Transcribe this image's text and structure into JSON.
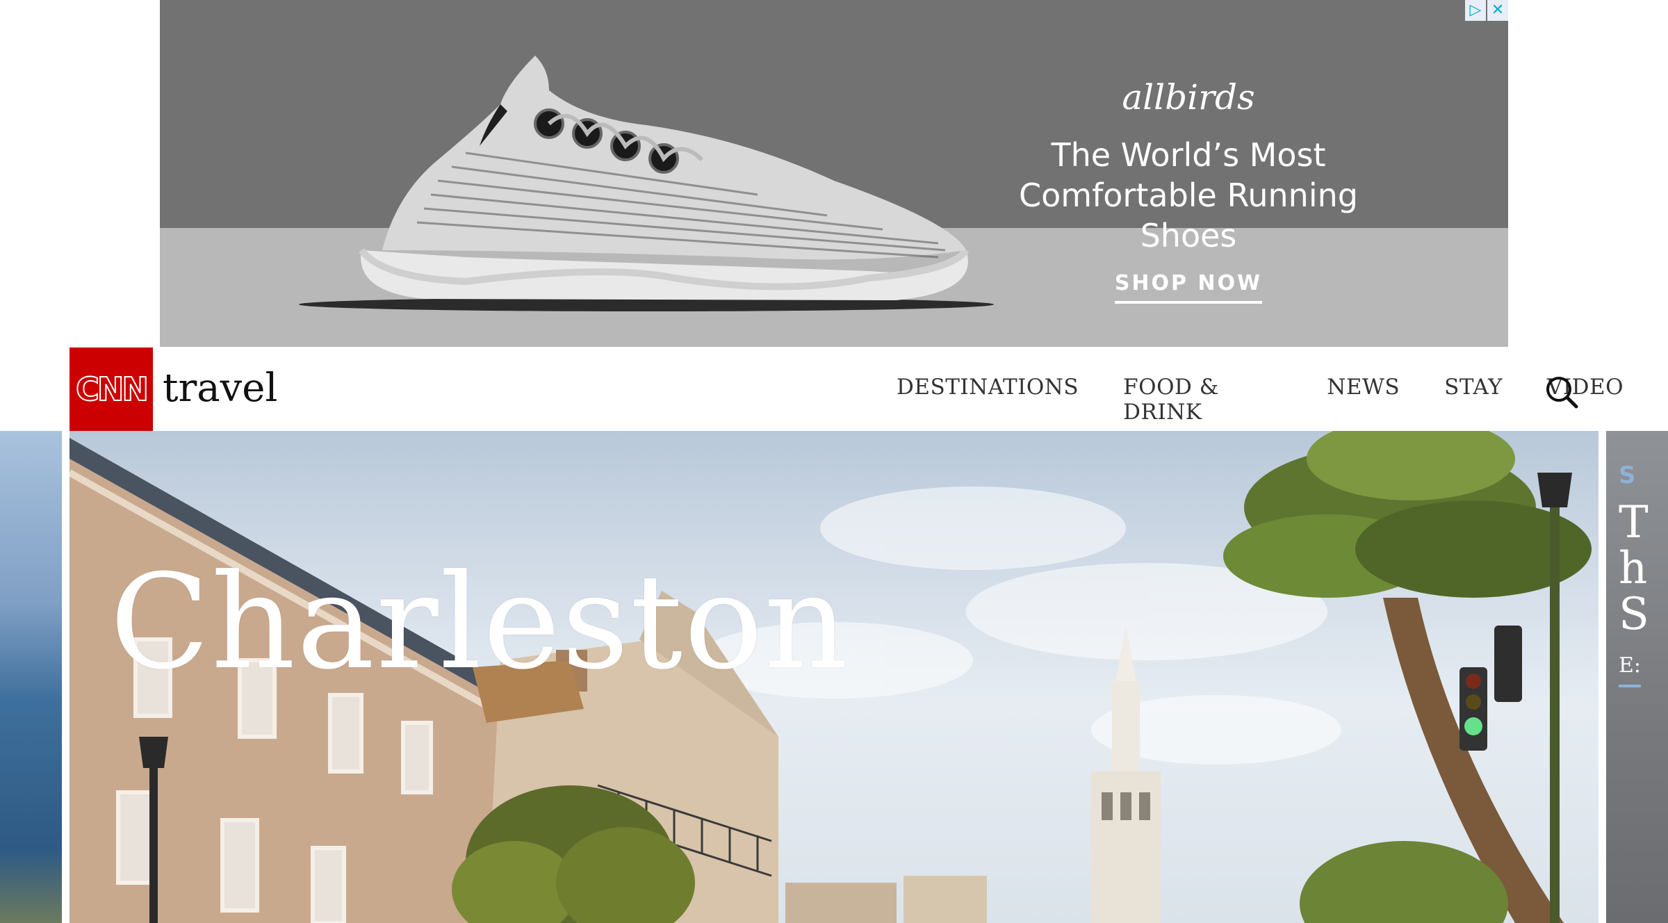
{
  "ad": {
    "brand": "allbirds",
    "headline_line1": "The World’s Most",
    "headline_line2": "Comfortable Running Shoes",
    "cta": "SHOP NOW",
    "adchoices_icon": "adchoices-icon",
    "close_icon": "close-icon"
  },
  "nav": {
    "logo": "CNN",
    "section": "travel",
    "items": [
      {
        "label": "DESTINATIONS"
      },
      {
        "label": "FOOD & DRINK"
      },
      {
        "label": "NEWS"
      },
      {
        "label": "STAY"
      },
      {
        "label": "VIDEO"
      }
    ],
    "search_icon": "search-icon"
  },
  "hero": {
    "title": "Charleston"
  },
  "next_slide": {
    "label_fragment": "S",
    "line1": "T",
    "line2": "h",
    "line3": "S",
    "link_fragment": "E:"
  },
  "colors": {
    "brand_red": "#cc0000",
    "ad_gray": "#727272",
    "accent_blue": "#8fb0d8"
  }
}
